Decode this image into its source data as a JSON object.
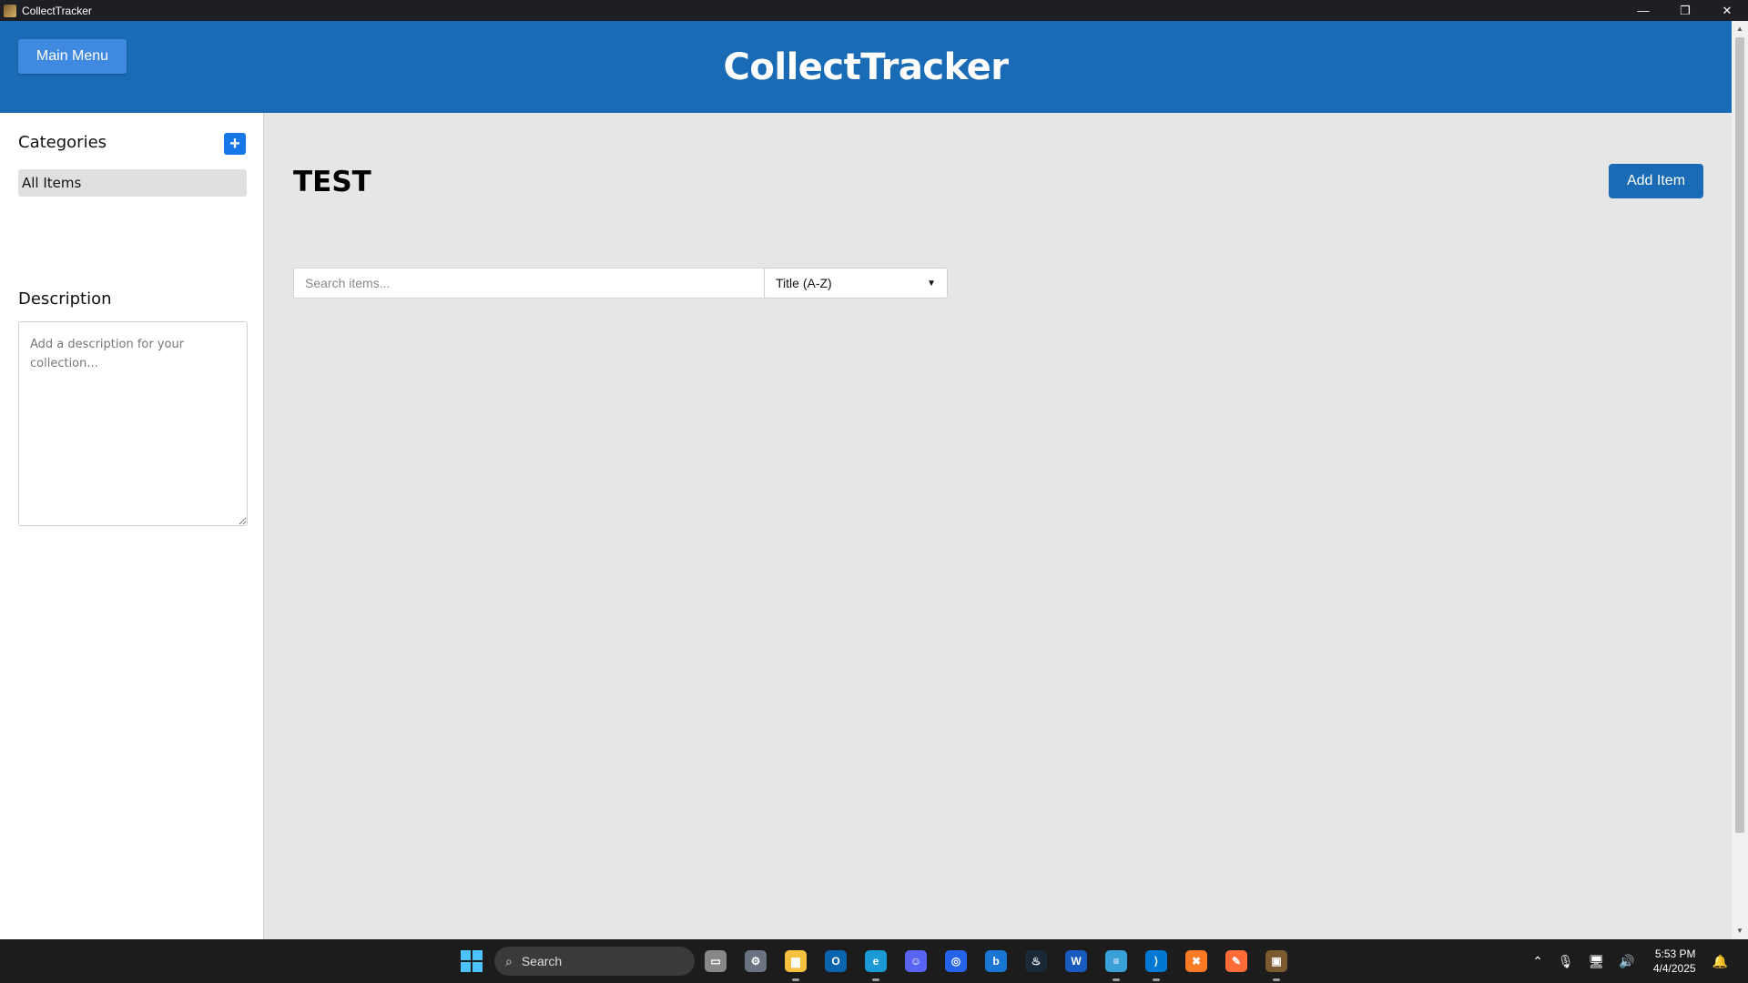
{
  "window": {
    "title": "CollectTracker",
    "controls": {
      "minimize": "—",
      "restore": "❐",
      "close": "✕"
    }
  },
  "header": {
    "main_menu_label": "Main Menu",
    "app_title": "CollectTracker"
  },
  "sidebar": {
    "categories_heading": "Categories",
    "add_category_label": "+",
    "categories": [
      {
        "label": "All Items",
        "selected": true
      }
    ],
    "description_heading": "Description",
    "description_placeholder": "Add a description for your collection...",
    "description_value": ""
  },
  "main": {
    "collection_title": "TEST",
    "add_item_label": "Add Item",
    "search_placeholder": "Search items...",
    "sort_selected": "Title (A-Z)"
  },
  "taskbar": {
    "search_label": "Search",
    "apps": [
      {
        "name": "task-view-icon",
        "glyph": "▭",
        "color": "#888888"
      },
      {
        "name": "settings-icon",
        "glyph": "⚙",
        "color": "#6b7280"
      },
      {
        "name": "file-explorer-icon",
        "glyph": "▆",
        "color": "#f6c23e"
      },
      {
        "name": "outlook-icon",
        "glyph": "O",
        "color": "#0a64ad"
      },
      {
        "name": "edge-icon",
        "glyph": "e",
        "color": "#1c9ad6"
      },
      {
        "name": "discord-icon",
        "glyph": "☺",
        "color": "#5865f2"
      },
      {
        "name": "app-blue-icon",
        "glyph": "◎",
        "color": "#2563eb"
      },
      {
        "name": "bing-icon",
        "glyph": "b",
        "color": "#1976d2"
      },
      {
        "name": "steam-icon",
        "glyph": "♨",
        "color": "#1b2838"
      },
      {
        "name": "word-icon",
        "glyph": "W",
        "color": "#185abd"
      },
      {
        "name": "notepad-icon",
        "glyph": "≡",
        "color": "#3aa0d8"
      },
      {
        "name": "vscode-icon",
        "glyph": "⟩",
        "color": "#0078d4"
      },
      {
        "name": "xampp-icon",
        "glyph": "✖",
        "color": "#fb7a24"
      },
      {
        "name": "postman-icon",
        "glyph": "✎",
        "color": "#ff6c37"
      },
      {
        "name": "collecttracker-taskbar-icon",
        "glyph": "▣",
        "color": "#7a5a2e"
      }
    ],
    "time": "5:53 PM",
    "date": "4/4/2025"
  },
  "colors": {
    "header": "#1a6bb5",
    "accent_button": "#3f8ae0",
    "add_category": "#1877e8",
    "main_bg": "#e6e6e6"
  }
}
